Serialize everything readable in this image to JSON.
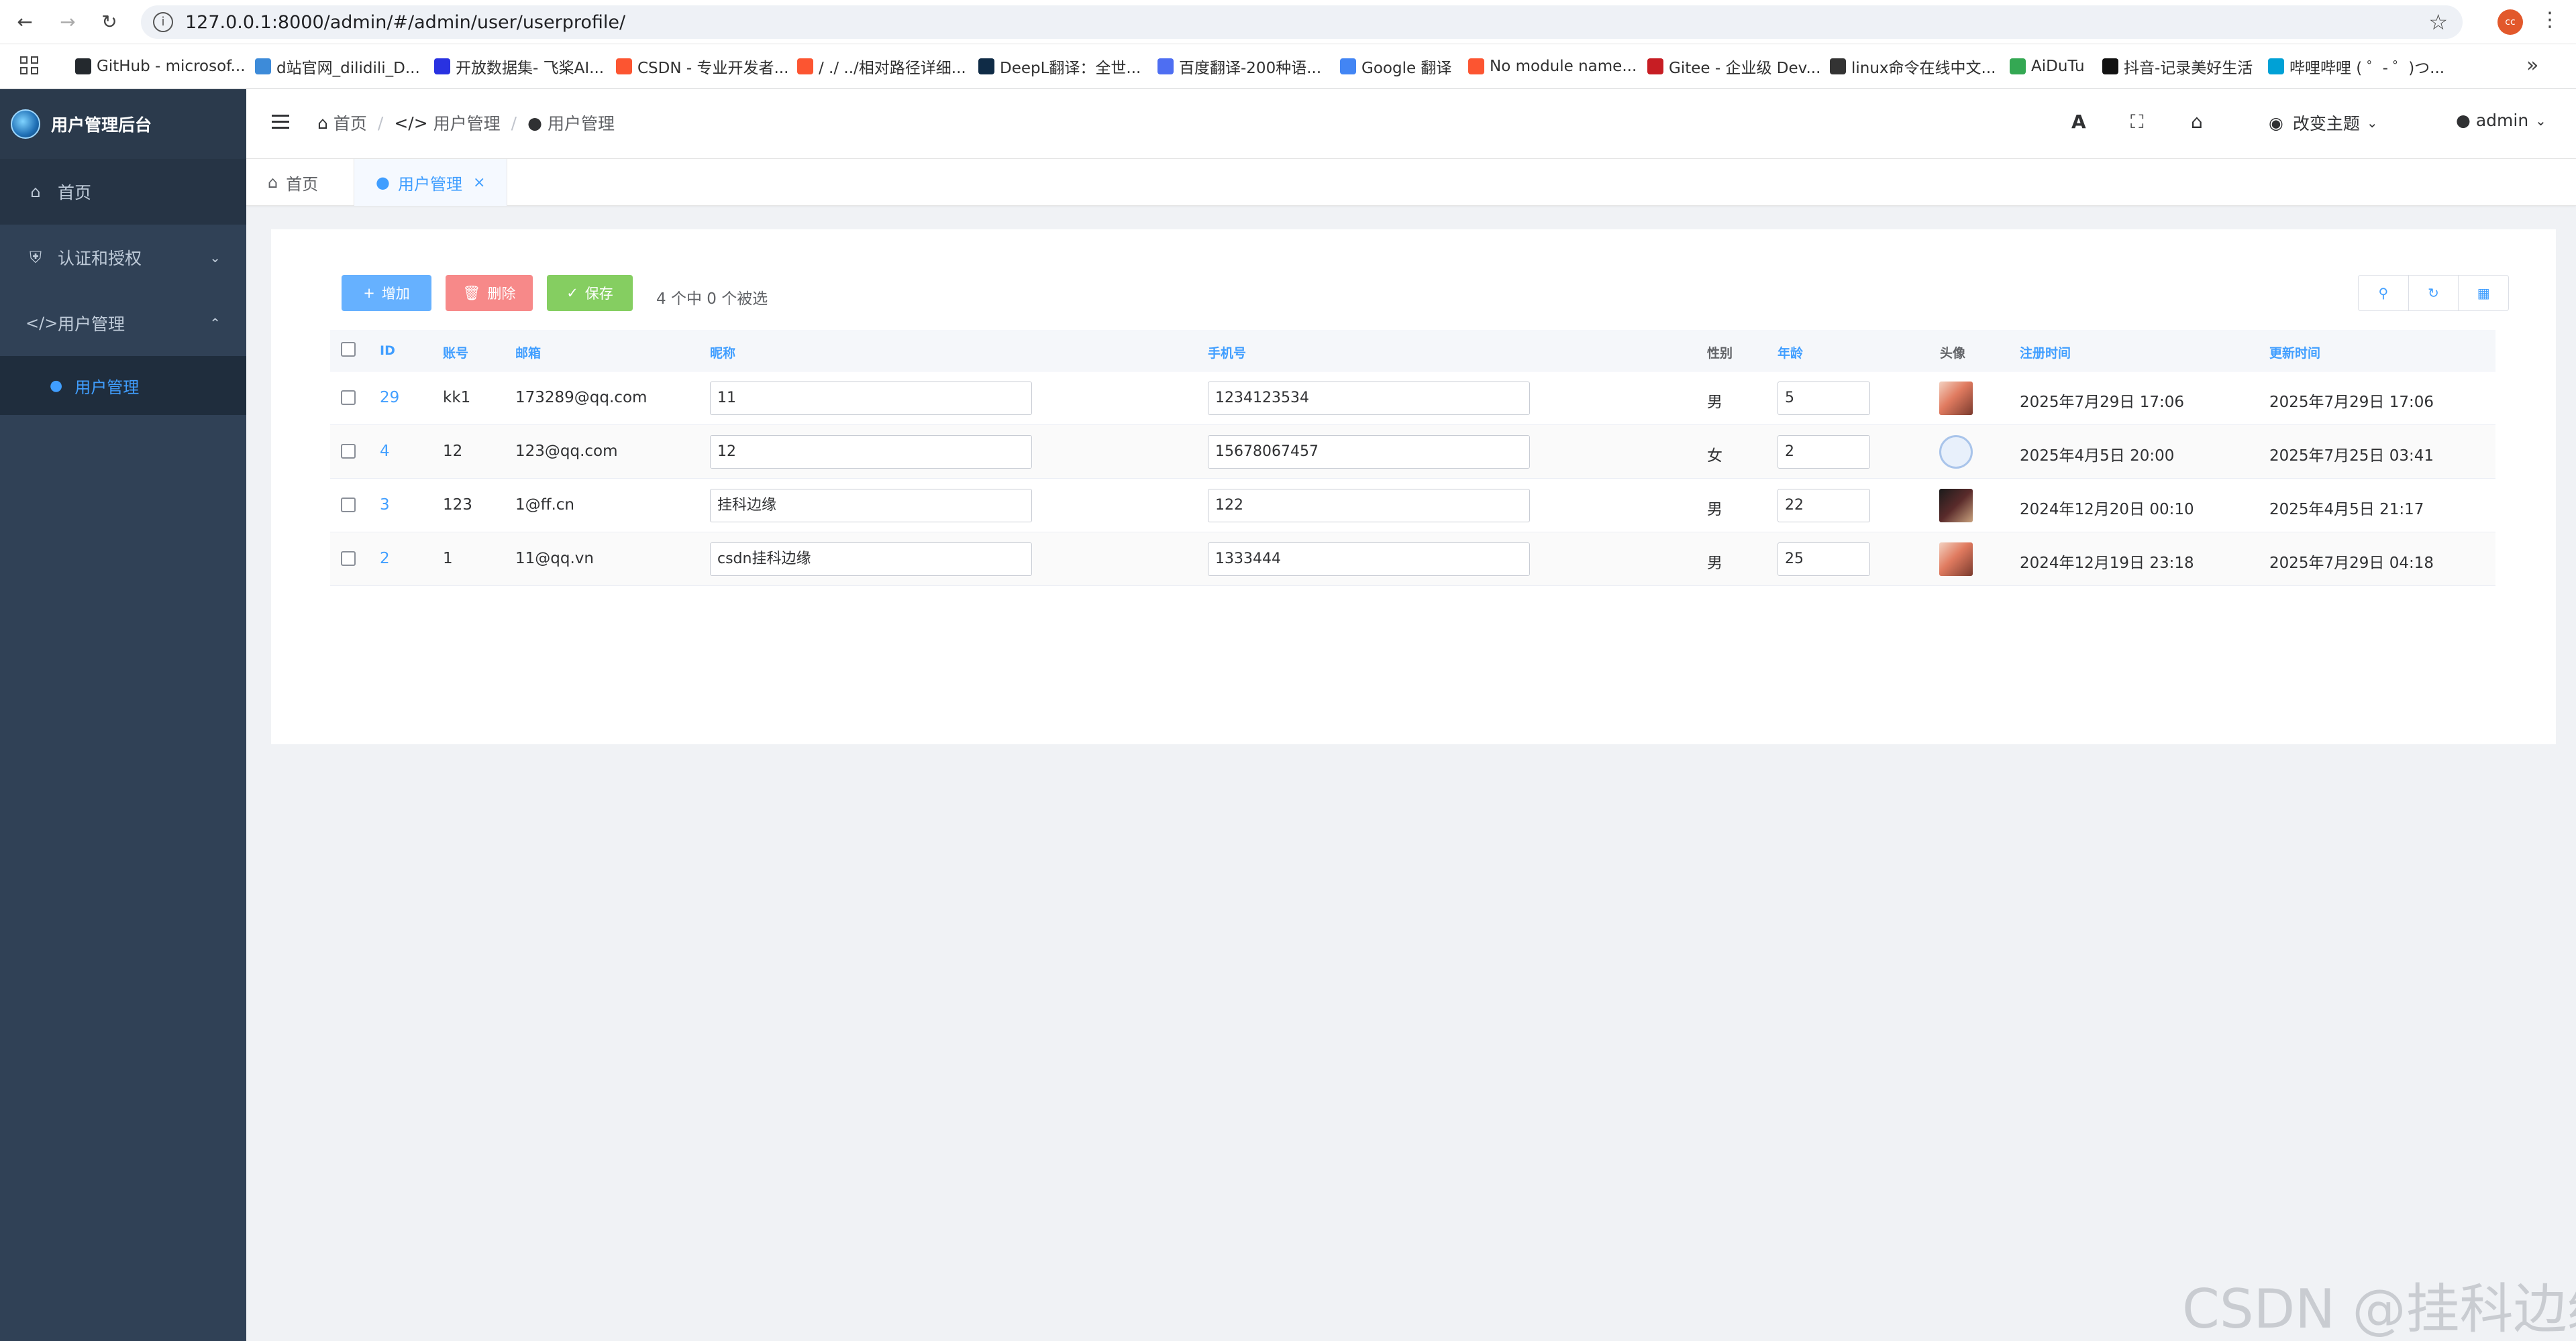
{
  "browser": {
    "url": "127.0.0.1:8000/admin/#/admin/user/userprofile/",
    "profile_initials": "cc",
    "bookmarks": [
      {
        "label": "GitHub - microsof...",
        "icon": "github-icon",
        "color": "#24292e"
      },
      {
        "label": "d站官网_dilidili_D...",
        "icon": "d-icon",
        "color": "#3d8bd9"
      },
      {
        "label": "开放数据集- 飞桨AI...",
        "icon": "paddle-icon",
        "color": "#2932e1"
      },
      {
        "label": "CSDN - 专业开发者...",
        "icon": "csdn-icon",
        "color": "#fc5531"
      },
      {
        "label": "/ ./ ../相对路径详细...",
        "icon": "csdn-icon",
        "color": "#fc5531"
      },
      {
        "label": "DeepL翻译：全世...",
        "icon": "deepl-icon",
        "color": "#0f2b46"
      },
      {
        "label": "百度翻译-200种语...",
        "icon": "baidu-translate-icon",
        "color": "#4e6ef2"
      },
      {
        "label": "Google 翻译",
        "icon": "google-translate-icon",
        "color": "#4285f4"
      },
      {
        "label": "No module name...",
        "icon": "csdn-icon",
        "color": "#fc5531"
      },
      {
        "label": "Gitee - 企业级 Dev...",
        "icon": "gitee-icon",
        "color": "#c71d23"
      },
      {
        "label": "linux命令在线中文...",
        "icon": "linux-icon",
        "color": "#333333"
      },
      {
        "label": "AiDuTu",
        "icon": "aidutu-icon",
        "color": "#34a853"
      },
      {
        "label": "抖音-记录美好生活",
        "icon": "tiktok-icon",
        "color": "#111111"
      },
      {
        "label": "哔哩哔哩 ( ゜- ゜)つ...",
        "icon": "bilibili-icon",
        "color": "#00a1d6"
      }
    ]
  },
  "sidebar": {
    "title": "用户管理后台",
    "items": [
      {
        "label": "首页",
        "icon": "home-icon"
      },
      {
        "label": "认证和授权",
        "icon": "shield-icon"
      },
      {
        "label": "用户管理",
        "icon": "code-icon"
      }
    ],
    "sub_items": [
      {
        "label": "用户管理",
        "icon": "user-icon"
      }
    ]
  },
  "navbar": {
    "breadcrumb": [
      "首页",
      "用户管理",
      "用户管理"
    ],
    "theme_label": "改变主题",
    "user_label": "admin"
  },
  "tags": [
    {
      "label": "首页",
      "active": false
    },
    {
      "label": "用户管理",
      "active": true
    }
  ],
  "toolbar": {
    "add_label": "增加",
    "delete_label": "删除",
    "save_label": "保存",
    "selection_text": "4 个中 0 个被选"
  },
  "table": {
    "columns": [
      "ID",
      "账号",
      "邮箱",
      "昵称",
      "手机号",
      "性别",
      "年龄",
      "头像",
      "注册时间",
      "更新时间"
    ],
    "rows": [
      {
        "id": "29",
        "account": "kk1",
        "email": "173289@qq.com",
        "nickname": "11",
        "phone": "1234123534",
        "gender": "男",
        "age": "5",
        "registered": "2025年7月29日 17:06",
        "updated": "2025年7月29日 17:06",
        "avatar": "anime-avatar"
      },
      {
        "id": "4",
        "account": "12",
        "email": "123@qq.com",
        "nickname": "12",
        "phone": "15678067457",
        "gender": "女",
        "age": "2",
        "registered": "2025年4月5日 20:00",
        "updated": "2025年7月25日 03:41",
        "avatar": "default-avatar"
      },
      {
        "id": "3",
        "account": "123",
        "email": "1@ff.cn",
        "nickname": "挂科边缘",
        "phone": "122",
        "gender": "男",
        "age": "22",
        "registered": "2024年12月20日 00:10",
        "updated": "2025年4月5日 21:17",
        "avatar": "dark-avatar"
      },
      {
        "id": "2",
        "account": "1",
        "email": "11@qq.vn",
        "nickname": "csdn挂科边缘",
        "phone": "1333444",
        "gender": "男",
        "age": "25",
        "registered": "2024年12月19日 23:18",
        "updated": "2025年7月29日 04:18",
        "avatar": "anime-avatar"
      }
    ]
  },
  "watermark": "CSDN @挂科边缘",
  "colors": {
    "sidebar_bg": "#304156",
    "accent": "#409eff",
    "danger": "#f78989",
    "success": "#85ce61"
  }
}
